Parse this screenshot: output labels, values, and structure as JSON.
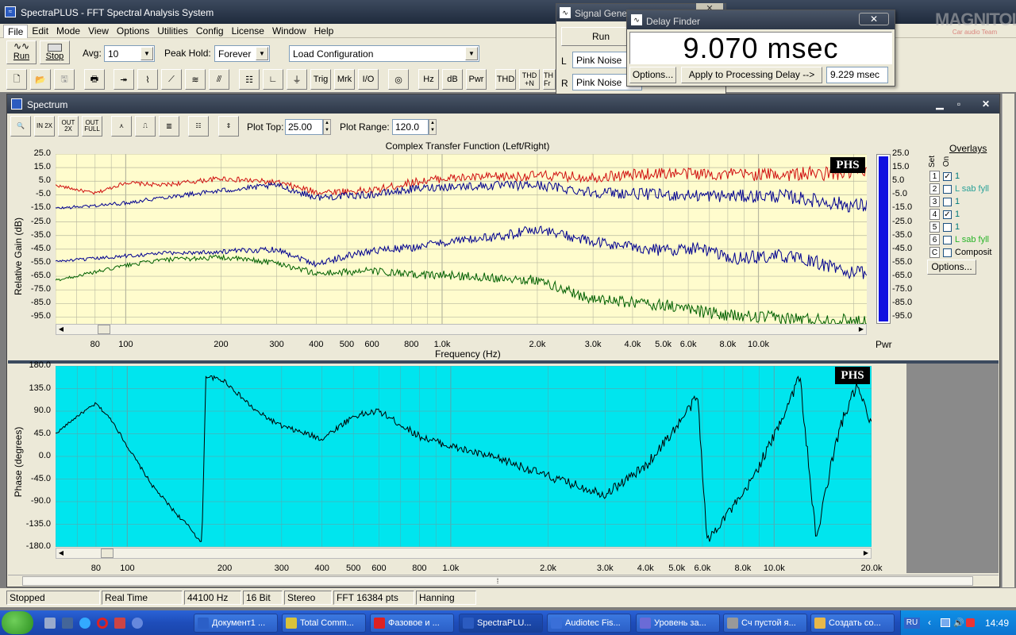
{
  "main_window": {
    "title": "SpectraPLUS - FFT Spectral Analysis System"
  },
  "menu": [
    "File",
    "Edit",
    "Mode",
    "View",
    "Options",
    "Utilities",
    "Config",
    "License",
    "Window",
    "Help"
  ],
  "toolbar1": {
    "run_label": "Run",
    "stop_label": "Stop",
    "avg_label": "Avg:",
    "avg_value": "10",
    "peak_hold_label": "Peak Hold:",
    "peak_hold_value": "Forever",
    "config_value": "Load Configuration"
  },
  "toolbar2": {
    "buttons": [
      "Trig",
      "Mrk",
      "I/O",
      "Hz",
      "dB",
      "Pwr",
      "THD",
      "THD +N",
      "TH Fr"
    ]
  },
  "signal_generator": {
    "title": "Signal Genera",
    "run_label": "Run",
    "l_label": "L",
    "r_label": "R",
    "l_value": "Pink Noise",
    "r_value": "Pink Noise"
  },
  "delay_finder": {
    "title": "Delay Finder",
    "value": "9.070 msec",
    "options_label": "Options...",
    "apply_label": "Apply to Processing Delay -->",
    "processing_delay": "9.229 msec"
  },
  "watermark": {
    "text": "MAGNITOLA",
    "sub": "Car audio Team"
  },
  "spectrum_window": {
    "title": "Spectrum",
    "toolbar_icons": [
      {
        "n": "zoom-icon",
        "t": "🔍"
      },
      {
        "n": "zoom-in-icon",
        "t": "IN 2X"
      },
      {
        "n": "zoom-out-icon",
        "t": "OUT 2X"
      },
      {
        "n": "zoom-full-icon",
        "t": "OUT FULL"
      },
      {
        "n": "line-view-icon",
        "t": "⋏"
      },
      {
        "n": "step-view-icon",
        "t": "⎍"
      },
      {
        "n": "bar-view-icon",
        "t": "▥"
      },
      {
        "n": "table-icon",
        "t": "☷"
      },
      {
        "n": "scale-icon",
        "t": "⇕"
      }
    ],
    "plot_top_label": "Plot Top:",
    "plot_top_value": "25.00",
    "plot_range_label": "Plot Range:",
    "plot_range_value": "120.0"
  },
  "overlays": {
    "title": "Overlays",
    "set_label": "Set",
    "on_label": "On",
    "options_label": "Options...",
    "rows": [
      {
        "num": "1",
        "checked": true,
        "label": "1",
        "color": "#007a7a"
      },
      {
        "num": "2",
        "checked": false,
        "label": "L sab fyll",
        "color": "#2aa198"
      },
      {
        "num": "3",
        "checked": false,
        "label": "1",
        "color": "#007a7a"
      },
      {
        "num": "4",
        "checked": true,
        "label": "1",
        "color": "#007a7a"
      },
      {
        "num": "5",
        "checked": false,
        "label": "1",
        "color": "#007a7a"
      },
      {
        "num": "6",
        "checked": false,
        "label": "L sab fyll",
        "color": "#28b428"
      },
      {
        "num": "C",
        "checked": false,
        "label": "Composit",
        "color": "#000000"
      }
    ]
  },
  "chart_data": [
    {
      "type": "line",
      "title": "Complex Transfer Function (Left/Right)",
      "xlabel": "Frequency (Hz)",
      "ylabel": "Relative Gain (dB)",
      "xscale": "log",
      "xlim": [
        60,
        22000
      ],
      "ylim": [
        -100,
        25
      ],
      "yticks": [
        "25.0",
        "15.0",
        "5.0",
        "-5.0",
        "-15.0",
        "-25.0",
        "-35.0",
        "-45.0",
        "-55.0",
        "-65.0",
        "-75.0",
        "-85.0",
        "-95.0"
      ],
      "xticks": [
        "80",
        "100",
        "200",
        "300",
        "400",
        "500",
        "600",
        "800",
        "1.0k",
        "2.0k",
        "3.0k",
        "4.0k",
        "5.0k",
        "6.0k",
        "8.0k",
        "10.0k"
      ],
      "badge": "PHS",
      "meter_label": "Pwr",
      "grid": true,
      "background": "#fffccd",
      "series": [
        {
          "color": "#d01010",
          "x": [
            60,
            80,
            100,
            130,
            200,
            300,
            400,
            600,
            800,
            1000,
            2000,
            3000,
            5000,
            8000,
            12000,
            20000
          ],
          "y": [
            2,
            -4,
            4,
            2,
            7,
            4,
            -3,
            -2,
            4,
            7,
            9,
            8,
            11,
            10,
            10,
            11
          ]
        },
        {
          "color": "#000090",
          "x": [
            60,
            80,
            100,
            130,
            200,
            300,
            400,
            600,
            800,
            1000,
            2000,
            3000,
            5000,
            8000,
            12000,
            20000
          ],
          "y": [
            -15,
            -13,
            -11,
            -7,
            -2,
            2,
            -7,
            -5,
            -1,
            1,
            2,
            -3,
            -5,
            -6,
            -6,
            -13
          ]
        },
        {
          "color": "#000090",
          "x": [
            60,
            80,
            100,
            130,
            200,
            300,
            400,
            500,
            600,
            800,
            1000,
            1500,
            2000,
            3000,
            5000,
            6500,
            8000,
            12000,
            16000,
            20000
          ],
          "y": [
            -54,
            -52,
            -50,
            -48,
            -47,
            -45,
            -56,
            -50,
            -46,
            -44,
            -40,
            -36,
            -30,
            -40,
            -46,
            -44,
            -52,
            -50,
            -56,
            -63
          ]
        },
        {
          "color": "#006000",
          "x": [
            60,
            80,
            100,
            130,
            200,
            300,
            400,
            600,
            800,
            1000,
            1500,
            2000,
            3000,
            5000,
            8000,
            12000,
            20000
          ],
          "y": [
            -68,
            -62,
            -57,
            -53,
            -51,
            -55,
            -63,
            -61,
            -64,
            -64,
            -66,
            -68,
            -82,
            -86,
            -94,
            -96,
            -98
          ]
        }
      ]
    },
    {
      "type": "line",
      "ylabel": "Phase (degrees)",
      "xscale": "log",
      "xlim": [
        60,
        20000
      ],
      "ylim": [
        -180,
        180
      ],
      "yticks": [
        "180.0",
        "135.0",
        "90.0",
        "45.0",
        "0.0",
        "-45.0",
        "-90.0",
        "-135.0",
        "-180.0"
      ],
      "xticks": [
        "80",
        "100",
        "200",
        "300",
        "400",
        "500",
        "600",
        "800",
        "1.0k",
        "2.0k",
        "3.0k",
        "4.0k",
        "5.0k",
        "6.0k",
        "8.0k",
        "10.0k",
        "20.0k"
      ],
      "badge": "PHS",
      "grid": true,
      "background": "#00e5ee",
      "series": [
        {
          "color": "#000000",
          "x": [
            60,
            70,
            80,
            90,
            100,
            120,
            140,
            160,
            170,
            175,
            200,
            250,
            300,
            400,
            500,
            600,
            800,
            1000,
            1500,
            2000,
            3000,
            4000,
            5000,
            5800,
            6200,
            7000,
            8000,
            10000,
            12000,
            13500,
            14500,
            16000,
            18000,
            20000
          ],
          "y": [
            45,
            80,
            105,
            70,
            20,
            -60,
            -110,
            -150,
            -175,
            160,
            150,
            90,
            60,
            35,
            80,
            90,
            40,
            20,
            -10,
            -40,
            -75,
            -20,
            60,
            120,
            -170,
            -120,
            -80,
            40,
            160,
            -170,
            -60,
            60,
            140,
            60
          ]
        }
      ]
    }
  ],
  "status_bar": {
    "items": [
      "Stopped",
      "Real Time",
      "44100 Hz",
      "16 Bit",
      "Stereo",
      "FFT 16384 pts",
      "Hanning"
    ]
  },
  "taskbar": {
    "items": [
      "Документ1 ...",
      "Total Comm...",
      "Фазовое и ...",
      "SpectraPLU...",
      "Audiotec Fis...",
      "Уровень за...",
      "Сч пустой я...",
      "Создать со..."
    ],
    "lang": "RU",
    "clock": "14:49"
  }
}
